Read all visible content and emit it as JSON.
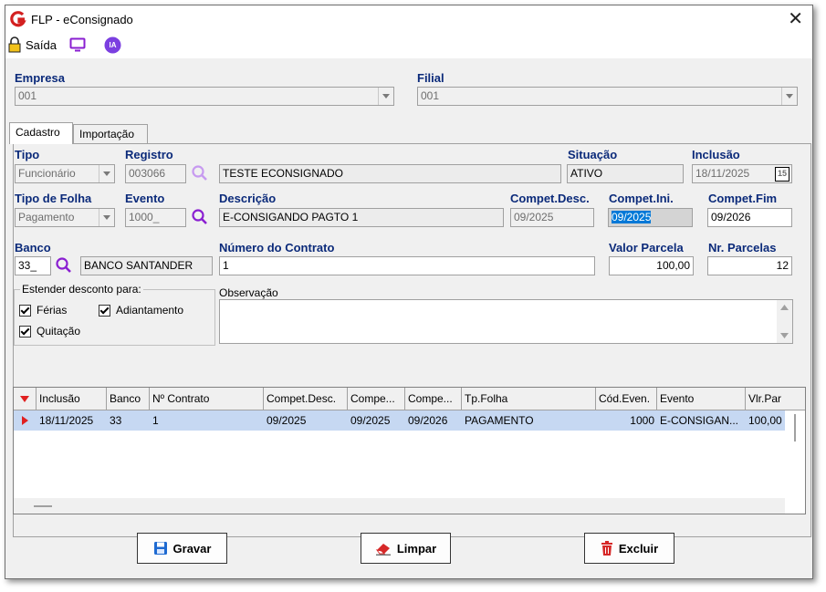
{
  "window": {
    "title": "FLP - eConsignado",
    "close": "✕"
  },
  "toolbar": {
    "exit_label": "Saída",
    "ia_label": "IA"
  },
  "empresa": {
    "label": "Empresa",
    "value": "001"
  },
  "filial": {
    "label": "Filial",
    "value": "001"
  },
  "tabs": [
    {
      "label": "Cadastro"
    },
    {
      "label": "Importação"
    }
  ],
  "form": {
    "tipo": {
      "label": "Tipo",
      "value": "Funcionário"
    },
    "registro": {
      "label": "Registro",
      "value": "003066",
      "name": "TESTE ECONSIGNADO"
    },
    "situacao": {
      "label": "Situação",
      "value": "ATIVO"
    },
    "inclusao": {
      "label": "Inclusão",
      "value": "18/11/2025",
      "calendar": "15"
    },
    "tipo_folha": {
      "label": "Tipo de Folha",
      "value": "Pagamento"
    },
    "evento": {
      "label": "Evento",
      "value": "1000_"
    },
    "descricao": {
      "label": "Descrição",
      "value": "E-CONSIGANDO PAGTO 1"
    },
    "compet_desc": {
      "label": "Compet.Desc.",
      "value": "09/2025"
    },
    "compet_ini": {
      "label": "Compet.Ini.",
      "value": "09/2025"
    },
    "compet_fim": {
      "label": "Compet.Fim",
      "value": "09/2026"
    },
    "banco": {
      "label": "Banco",
      "value": "33_",
      "name": "BANCO SANTANDER"
    },
    "numero_contrato": {
      "label": "Número do Contrato",
      "value": "1"
    },
    "valor_parcela": {
      "label": "Valor Parcela",
      "value": "100,00"
    },
    "nr_parcelas": {
      "label": "Nr. Parcelas",
      "value": "12"
    },
    "estender": {
      "title": "Estender desconto para:",
      "ferias": "Férias",
      "adiantamento": "Adiantamento",
      "quitacao": "Quitação"
    },
    "observacao": {
      "label": "Observação",
      "value": ""
    }
  },
  "grid": {
    "columns": [
      "Inclusão",
      "Banco",
      "Nº Contrato",
      "Compet.Desc.",
      "Compe...",
      "Compe...",
      "Tp.Folha",
      "Cód.Even.",
      "Evento",
      "Vlr.Par"
    ],
    "rows": [
      [
        "18/11/2025",
        "33",
        "1",
        "09/2025",
        "09/2025",
        "09/2026",
        "PAGAMENTO",
        "1000",
        "E-CONSIGAN...",
        "100,00"
      ]
    ]
  },
  "buttons": {
    "gravar": "Gravar",
    "limpar": "Limpar",
    "excluir": "Excluir"
  },
  "colors": {
    "label_blue": "#0b2a7a",
    "selection": "#0078d7",
    "row_highlight": "#c6d8f2",
    "search_purple": "#8a3fd1"
  }
}
